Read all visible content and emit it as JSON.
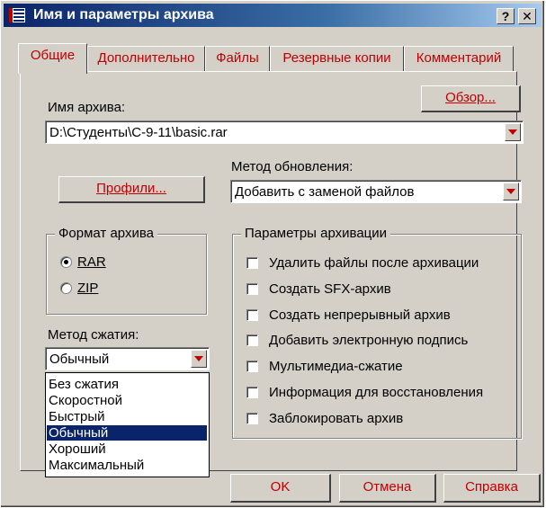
{
  "window": {
    "title": "Имя и параметры архива",
    "help_btn": "?",
    "close_btn": "✕",
    "accent_color": "#0a246a",
    "label_color": "#c00000"
  },
  "tabs": [
    {
      "label": "Общие",
      "active": true
    },
    {
      "label": "Дополнительно"
    },
    {
      "label": "Файлы"
    },
    {
      "label": "Резервные копии"
    },
    {
      "label": "Комментарий"
    }
  ],
  "archive_name": {
    "label": "Имя архива:",
    "value": "D:\\Студенты\\С-9-11\\basic.rar",
    "browse_button": "Обзор..."
  },
  "profiles_button": "Профили...",
  "update_method": {
    "label": "Метод обновления:",
    "value": "Добавить с заменой файлов"
  },
  "archive_format": {
    "legend": "Формат архива",
    "options": [
      "RAR",
      "ZIP"
    ],
    "selected": "RAR"
  },
  "archive_params": {
    "legend": "Параметры архивации",
    "options": [
      "Удалить файлы после архивации",
      "Создать SFX-архив",
      "Создать непрерывный архив",
      "Добавить электронную подпись",
      "Мультимедиа-сжатие",
      "Информация для восстановления",
      "Заблокировать архив"
    ]
  },
  "compression": {
    "label": "Метод сжатия:",
    "value": "Обычный",
    "options": [
      "Без сжатия",
      "Скоростной",
      "Быстрый",
      "Обычный",
      "Хороший",
      "Максимальный"
    ],
    "selected_index": 3
  },
  "buttons": {
    "ok": "OK",
    "cancel": "Отмена",
    "help": "Справка"
  }
}
